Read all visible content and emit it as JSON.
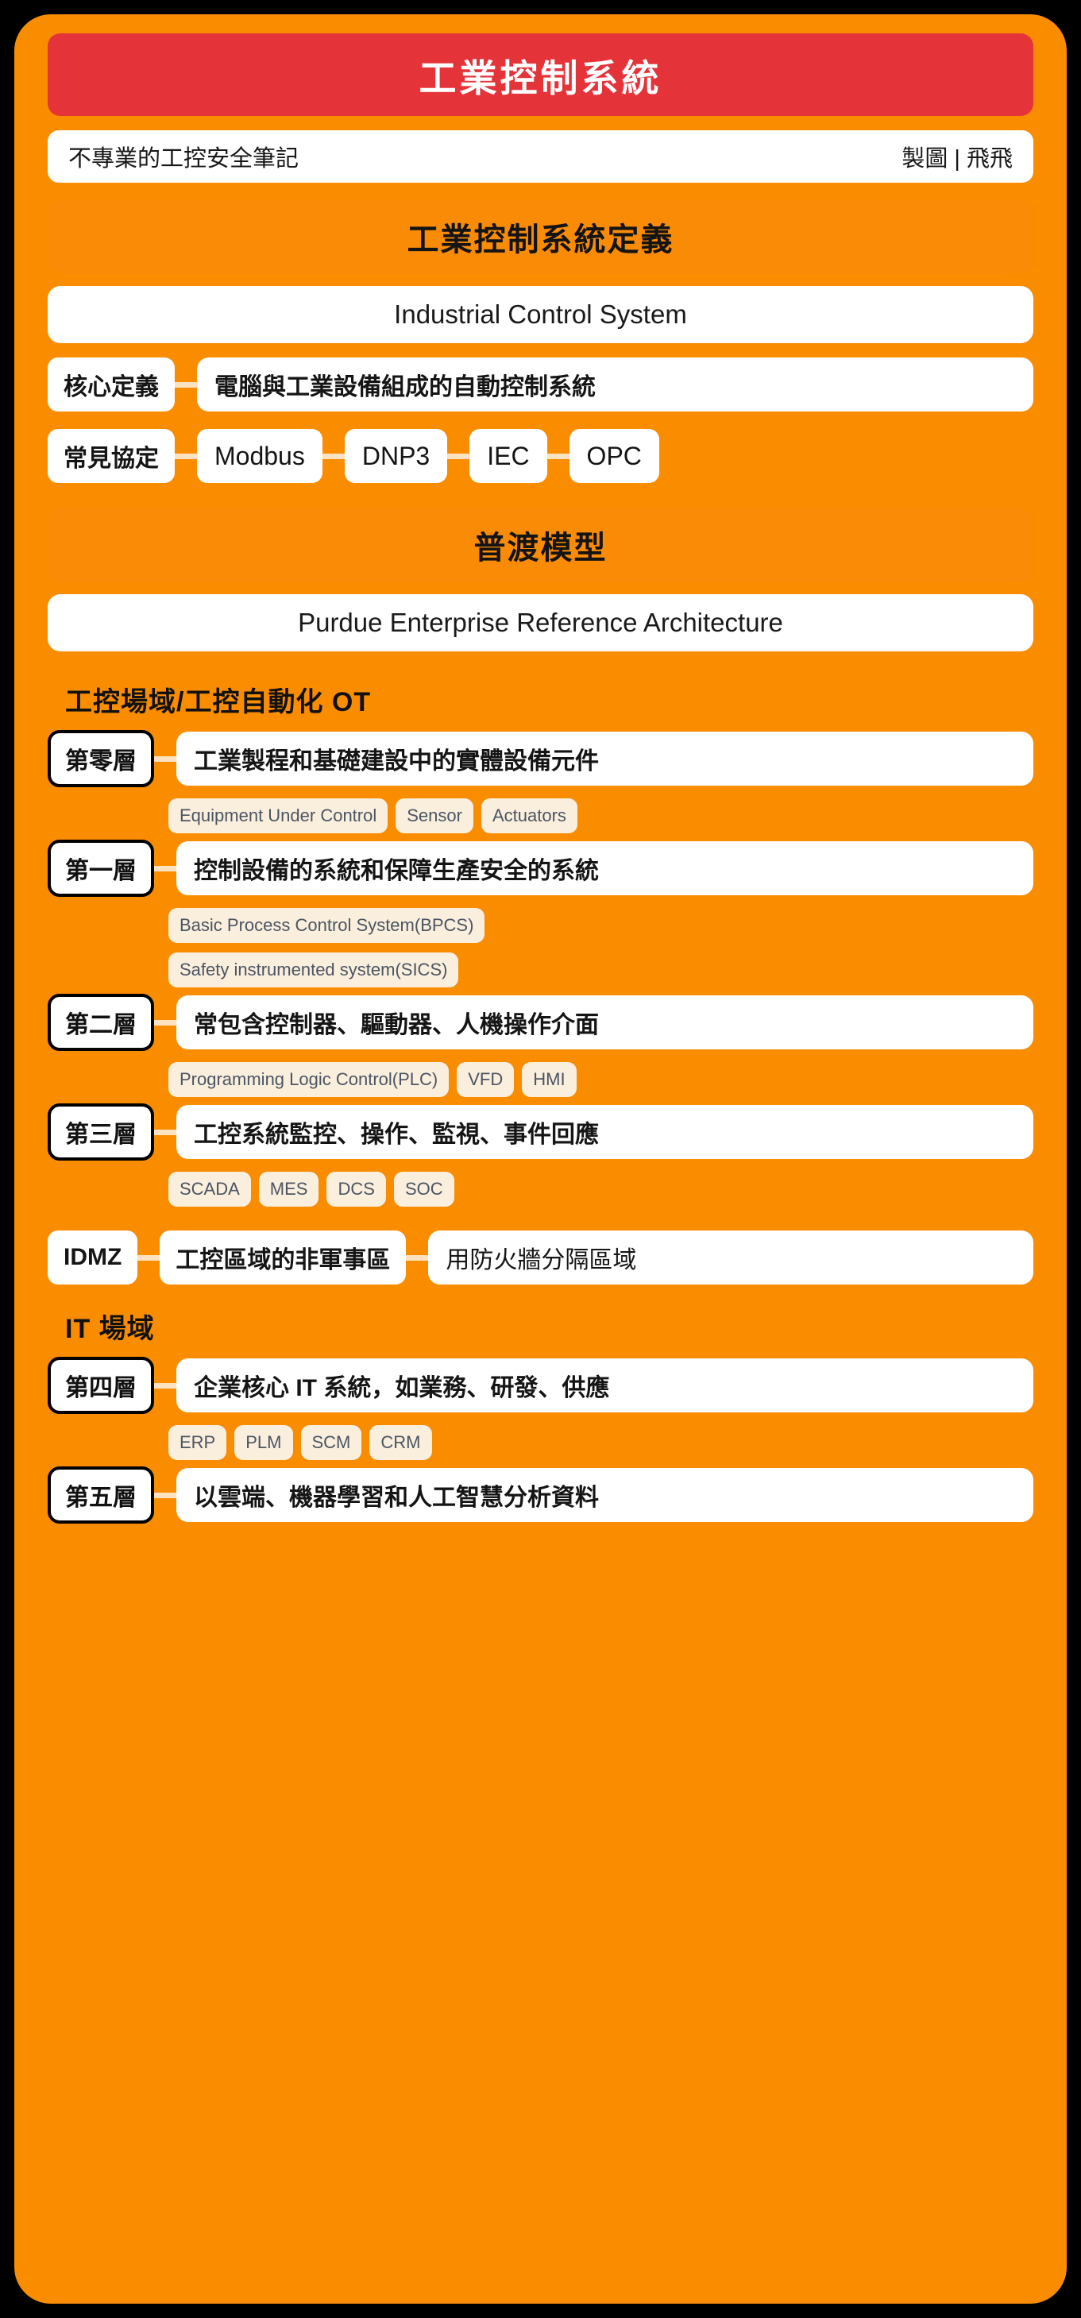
{
  "colors": {
    "background": "#000000",
    "canvas": "#FA8C00",
    "title_bar": "#E5333A",
    "section_bar": "#F98B07",
    "card": "#FFFFFF",
    "tag_bg": "#FAEEDD",
    "tag_text": "#4B5563",
    "connector": "#FCE2C0"
  },
  "header": {
    "title": "工業控制系統"
  },
  "credit": {
    "left": "不專業的工控安全筆記",
    "right": "製圖 | 飛飛"
  },
  "sections": {
    "definition": {
      "heading": "工業控制系統定義",
      "subtitle": "Industrial Control System",
      "core": {
        "label": "核心定義",
        "text": "電腦與工業設備組成的自動控制系統"
      },
      "protocols": {
        "label": "常見協定",
        "items": [
          "Modbus",
          "DNP3",
          "IEC",
          "OPC"
        ]
      }
    },
    "purdue": {
      "heading": "普渡模型",
      "subtitle": "Purdue Enterprise Reference Architecture",
      "ot_group_heading": "工控場域/工控自動化 OT",
      "it_group_heading": "IT 場域",
      "layers": [
        {
          "label": "第零層",
          "text": "工業製程和基礎建設中的實體設備元件",
          "tags": [
            "Equipment Under Control",
            "Sensor",
            "Actuators"
          ]
        },
        {
          "label": "第一層",
          "text": "控制設備的系統和保障生產安全的系統",
          "tags": [
            "Basic Process Control System(BPCS)",
            "Safety instrumented system(SICS)"
          ]
        },
        {
          "label": "第二層",
          "text": "常包含控制器、驅動器、人機操作介面",
          "tags": [
            "Programming Logic Control(PLC)",
            "VFD",
            "HMI"
          ]
        },
        {
          "label": "第三層",
          "text": "工控系統監控、操作、監視、事件回應",
          "tags": [
            "SCADA",
            "MES",
            "DCS",
            "SOC"
          ]
        }
      ],
      "idmz": {
        "label": "IDMZ",
        "middle": "工控區域的非軍事區",
        "right": "用防火牆分隔區域"
      },
      "it_layers": [
        {
          "label": "第四層",
          "text": "企業核心 IT 系統，如業務、研發、供應",
          "tags": [
            "ERP",
            "PLM",
            "SCM",
            "CRM"
          ]
        },
        {
          "label": "第五層",
          "text": "以雲端、機器學習和人工智慧分析資料",
          "tags": []
        }
      ]
    }
  }
}
